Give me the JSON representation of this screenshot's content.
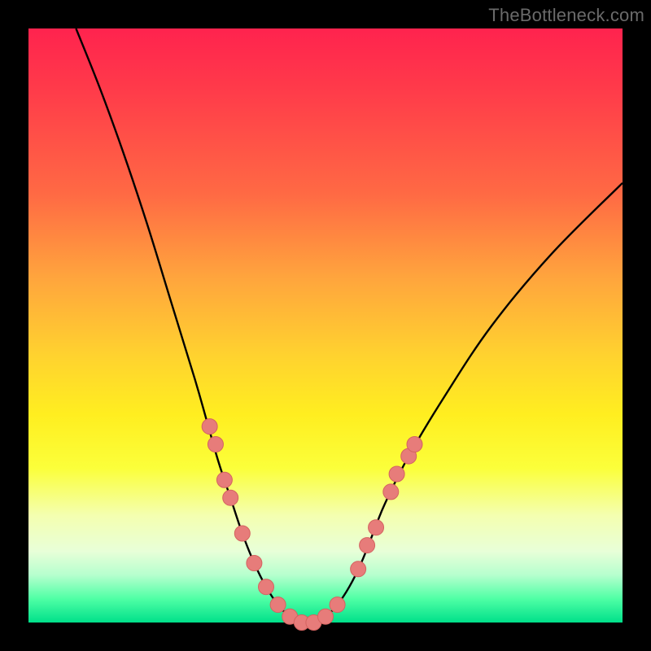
{
  "watermark": "TheBottleneck.com",
  "colors": {
    "frame": "#000000",
    "curve": "#000000",
    "marker_fill": "#e77c7a",
    "marker_stroke": "#d46360"
  },
  "chart_data": {
    "type": "line",
    "title": "",
    "xlabel": "",
    "ylabel": "",
    "xlim": [
      0,
      100
    ],
    "ylim": [
      0,
      100
    ],
    "grid": false,
    "curve_note": "V-shaped bottleneck curve; apex near x≈45, y≈0",
    "series": [
      {
        "name": "bottleneck-curve",
        "x": [
          8,
          12,
          16,
          20,
          24,
          28,
          30,
          32,
          34,
          36,
          38,
          40,
          42,
          44,
          46,
          48,
          50,
          52,
          54,
          56,
          58,
          60,
          64,
          70,
          78,
          88,
          100
        ],
        "y": [
          100,
          90,
          79,
          67,
          54,
          41,
          34,
          27,
          21,
          15,
          10,
          6,
          3,
          1,
          0,
          0,
          1,
          3,
          6,
          10,
          15,
          20,
          28,
          38,
          50,
          62,
          74
        ]
      }
    ],
    "markers_note": "Salmon dots clustered on lower limbs and along the flat trough",
    "markers": [
      {
        "x": 30.5,
        "y": 33
      },
      {
        "x": 31.5,
        "y": 30
      },
      {
        "x": 33.0,
        "y": 24
      },
      {
        "x": 34.0,
        "y": 21
      },
      {
        "x": 36.0,
        "y": 15
      },
      {
        "x": 38.0,
        "y": 10
      },
      {
        "x": 40.0,
        "y": 6
      },
      {
        "x": 42.0,
        "y": 3
      },
      {
        "x": 44.0,
        "y": 1
      },
      {
        "x": 46.0,
        "y": 0
      },
      {
        "x": 48.0,
        "y": 0
      },
      {
        "x": 50.0,
        "y": 1
      },
      {
        "x": 52.0,
        "y": 3
      },
      {
        "x": 55.5,
        "y": 9
      },
      {
        "x": 57.0,
        "y": 13
      },
      {
        "x": 58.5,
        "y": 16
      },
      {
        "x": 61.0,
        "y": 22
      },
      {
        "x": 62.0,
        "y": 25
      },
      {
        "x": 64.0,
        "y": 28
      },
      {
        "x": 65.0,
        "y": 30
      }
    ]
  }
}
